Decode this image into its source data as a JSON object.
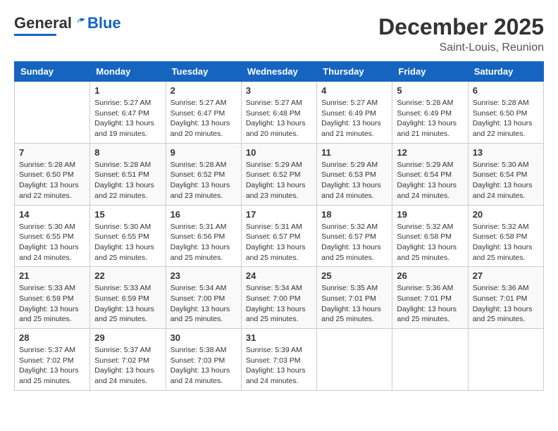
{
  "header": {
    "logo_general": "General",
    "logo_blue": "Blue",
    "month_year": "December 2025",
    "location": "Saint-Louis, Reunion"
  },
  "weekdays": [
    "Sunday",
    "Monday",
    "Tuesday",
    "Wednesday",
    "Thursday",
    "Friday",
    "Saturday"
  ],
  "weeks": [
    [
      {
        "day": "",
        "info": ""
      },
      {
        "day": "1",
        "info": "Sunrise: 5:27 AM\nSunset: 6:47 PM\nDaylight: 13 hours\nand 19 minutes."
      },
      {
        "day": "2",
        "info": "Sunrise: 5:27 AM\nSunset: 6:47 PM\nDaylight: 13 hours\nand 20 minutes."
      },
      {
        "day": "3",
        "info": "Sunrise: 5:27 AM\nSunset: 6:48 PM\nDaylight: 13 hours\nand 20 minutes."
      },
      {
        "day": "4",
        "info": "Sunrise: 5:27 AM\nSunset: 6:49 PM\nDaylight: 13 hours\nand 21 minutes."
      },
      {
        "day": "5",
        "info": "Sunrise: 5:28 AM\nSunset: 6:49 PM\nDaylight: 13 hours\nand 21 minutes."
      },
      {
        "day": "6",
        "info": "Sunrise: 5:28 AM\nSunset: 6:50 PM\nDaylight: 13 hours\nand 22 minutes."
      }
    ],
    [
      {
        "day": "7",
        "info": "Sunrise: 5:28 AM\nSunset: 6:50 PM\nDaylight: 13 hours\nand 22 minutes."
      },
      {
        "day": "8",
        "info": "Sunrise: 5:28 AM\nSunset: 6:51 PM\nDaylight: 13 hours\nand 22 minutes."
      },
      {
        "day": "9",
        "info": "Sunrise: 5:28 AM\nSunset: 6:52 PM\nDaylight: 13 hours\nand 23 minutes."
      },
      {
        "day": "10",
        "info": "Sunrise: 5:29 AM\nSunset: 6:52 PM\nDaylight: 13 hours\nand 23 minutes."
      },
      {
        "day": "11",
        "info": "Sunrise: 5:29 AM\nSunset: 6:53 PM\nDaylight: 13 hours\nand 24 minutes."
      },
      {
        "day": "12",
        "info": "Sunrise: 5:29 AM\nSunset: 6:54 PM\nDaylight: 13 hours\nand 24 minutes."
      },
      {
        "day": "13",
        "info": "Sunrise: 5:30 AM\nSunset: 6:54 PM\nDaylight: 13 hours\nand 24 minutes."
      }
    ],
    [
      {
        "day": "14",
        "info": "Sunrise: 5:30 AM\nSunset: 6:55 PM\nDaylight: 13 hours\nand 24 minutes."
      },
      {
        "day": "15",
        "info": "Sunrise: 5:30 AM\nSunset: 6:55 PM\nDaylight: 13 hours\nand 25 minutes."
      },
      {
        "day": "16",
        "info": "Sunrise: 5:31 AM\nSunset: 6:56 PM\nDaylight: 13 hours\nand 25 minutes."
      },
      {
        "day": "17",
        "info": "Sunrise: 5:31 AM\nSunset: 6:57 PM\nDaylight: 13 hours\nand 25 minutes."
      },
      {
        "day": "18",
        "info": "Sunrise: 5:32 AM\nSunset: 6:57 PM\nDaylight: 13 hours\nand 25 minutes."
      },
      {
        "day": "19",
        "info": "Sunrise: 5:32 AM\nSunset: 6:58 PM\nDaylight: 13 hours\nand 25 minutes."
      },
      {
        "day": "20",
        "info": "Sunrise: 5:32 AM\nSunset: 6:58 PM\nDaylight: 13 hours\nand 25 minutes."
      }
    ],
    [
      {
        "day": "21",
        "info": "Sunrise: 5:33 AM\nSunset: 6:59 PM\nDaylight: 13 hours\nand 25 minutes."
      },
      {
        "day": "22",
        "info": "Sunrise: 5:33 AM\nSunset: 6:59 PM\nDaylight: 13 hours\nand 25 minutes."
      },
      {
        "day": "23",
        "info": "Sunrise: 5:34 AM\nSunset: 7:00 PM\nDaylight: 13 hours\nand 25 minutes."
      },
      {
        "day": "24",
        "info": "Sunrise: 5:34 AM\nSunset: 7:00 PM\nDaylight: 13 hours\nand 25 minutes."
      },
      {
        "day": "25",
        "info": "Sunrise: 5:35 AM\nSunset: 7:01 PM\nDaylight: 13 hours\nand 25 minutes."
      },
      {
        "day": "26",
        "info": "Sunrise: 5:36 AM\nSunset: 7:01 PM\nDaylight: 13 hours\nand 25 minutes."
      },
      {
        "day": "27",
        "info": "Sunrise: 5:36 AM\nSunset: 7:01 PM\nDaylight: 13 hours\nand 25 minutes."
      }
    ],
    [
      {
        "day": "28",
        "info": "Sunrise: 5:37 AM\nSunset: 7:02 PM\nDaylight: 13 hours\nand 25 minutes."
      },
      {
        "day": "29",
        "info": "Sunrise: 5:37 AM\nSunset: 7:02 PM\nDaylight: 13 hours\nand 24 minutes."
      },
      {
        "day": "30",
        "info": "Sunrise: 5:38 AM\nSunset: 7:03 PM\nDaylight: 13 hours\nand 24 minutes."
      },
      {
        "day": "31",
        "info": "Sunrise: 5:39 AM\nSunset: 7:03 PM\nDaylight: 13 hours\nand 24 minutes."
      },
      {
        "day": "",
        "info": ""
      },
      {
        "day": "",
        "info": ""
      },
      {
        "day": "",
        "info": ""
      }
    ]
  ]
}
